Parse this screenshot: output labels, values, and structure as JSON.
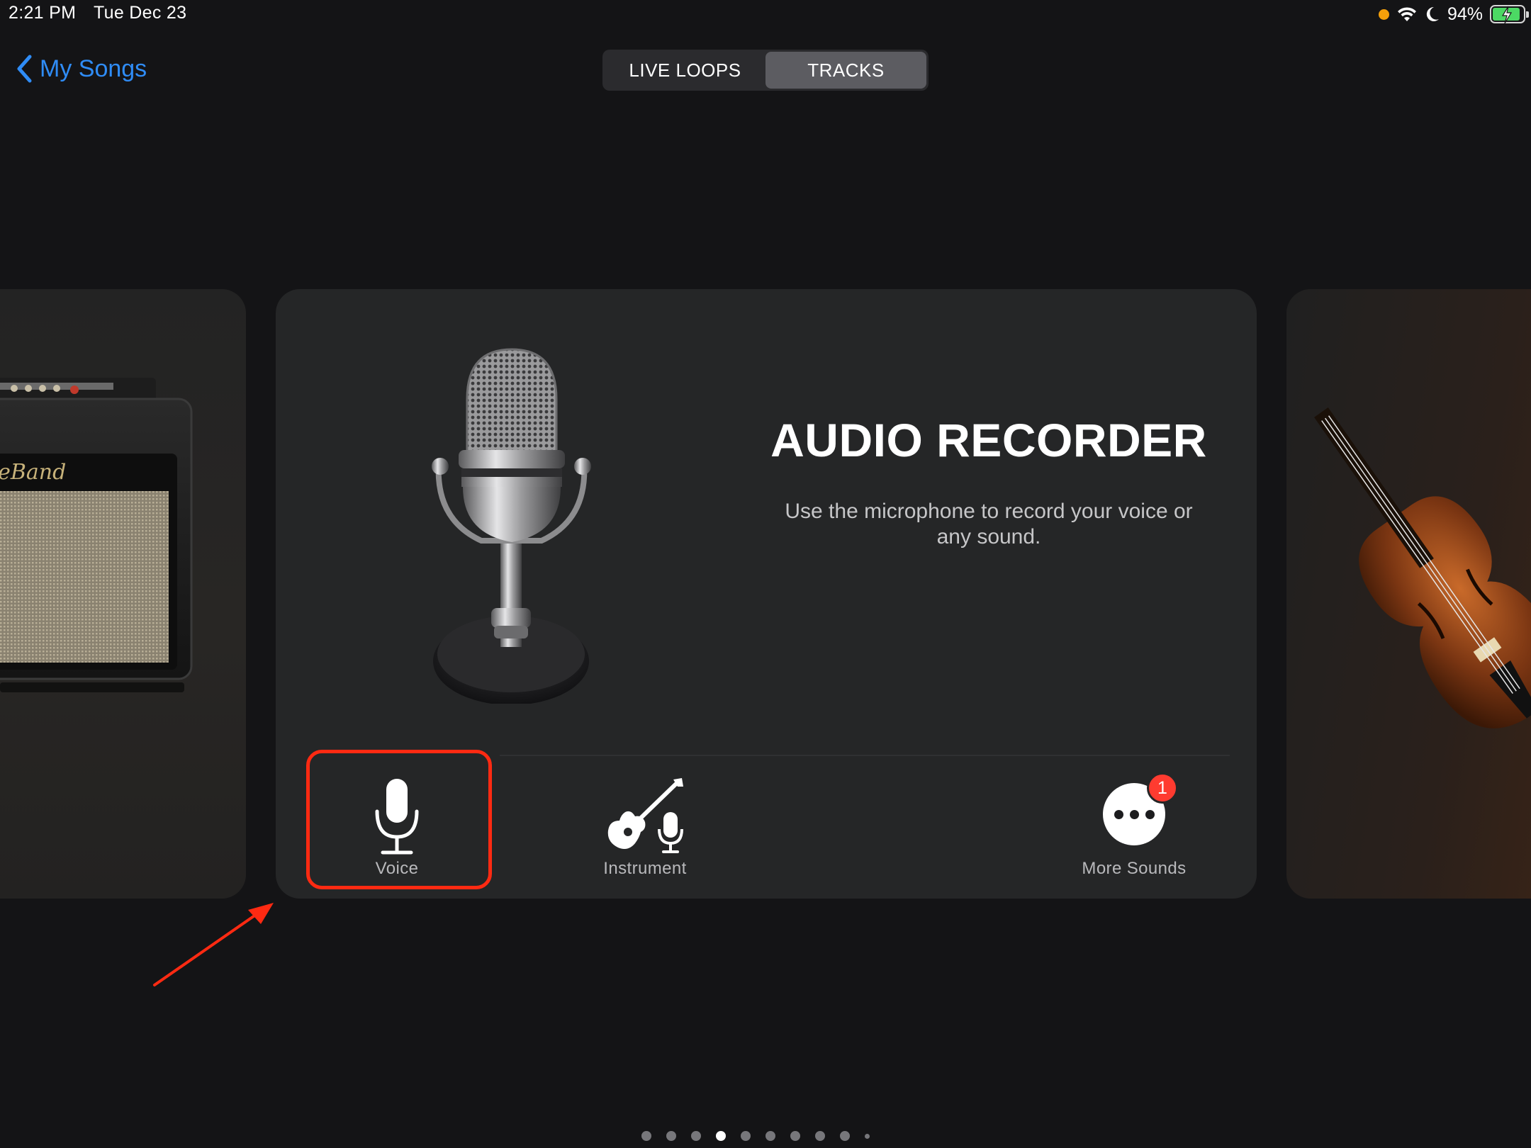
{
  "status_bar": {
    "time": "2:21 PM",
    "date": "Tue Dec 23",
    "battery": "94%",
    "icons": [
      "privacy-dot-icon",
      "wifi-icon",
      "focus-moon-icon",
      "battery-charging-icon"
    ]
  },
  "nav": {
    "back_label": "My Songs",
    "tabs": [
      {
        "label": "LIVE LOOPS",
        "active": false
      },
      {
        "label": "TRACKS",
        "active": true
      }
    ]
  },
  "cards": {
    "left": {
      "instrument": "amp-instrument",
      "logo_text": "GarageBand"
    },
    "main": {
      "title": "AUDIO RECORDER",
      "description": "Use the microphone to record your voice or any sound.",
      "options": [
        {
          "label": "Voice",
          "icon": "microphone-icon",
          "highlighted": true
        },
        {
          "label": "Instrument",
          "icon": "guitar-mic-icon"
        },
        {
          "label": "More Sounds",
          "icon": "ellipsis-icon",
          "badge": "1"
        }
      ]
    },
    "right": {
      "instrument": "violin-instrument"
    }
  },
  "annotation": {
    "highlight_color": "#ff2a12",
    "arrow_color": "#ff2a12"
  },
  "colors": {
    "accent": "#2f8cf6",
    "background": "#141416",
    "card": "#252627"
  },
  "pagination": {
    "total": 10,
    "current": 4
  }
}
